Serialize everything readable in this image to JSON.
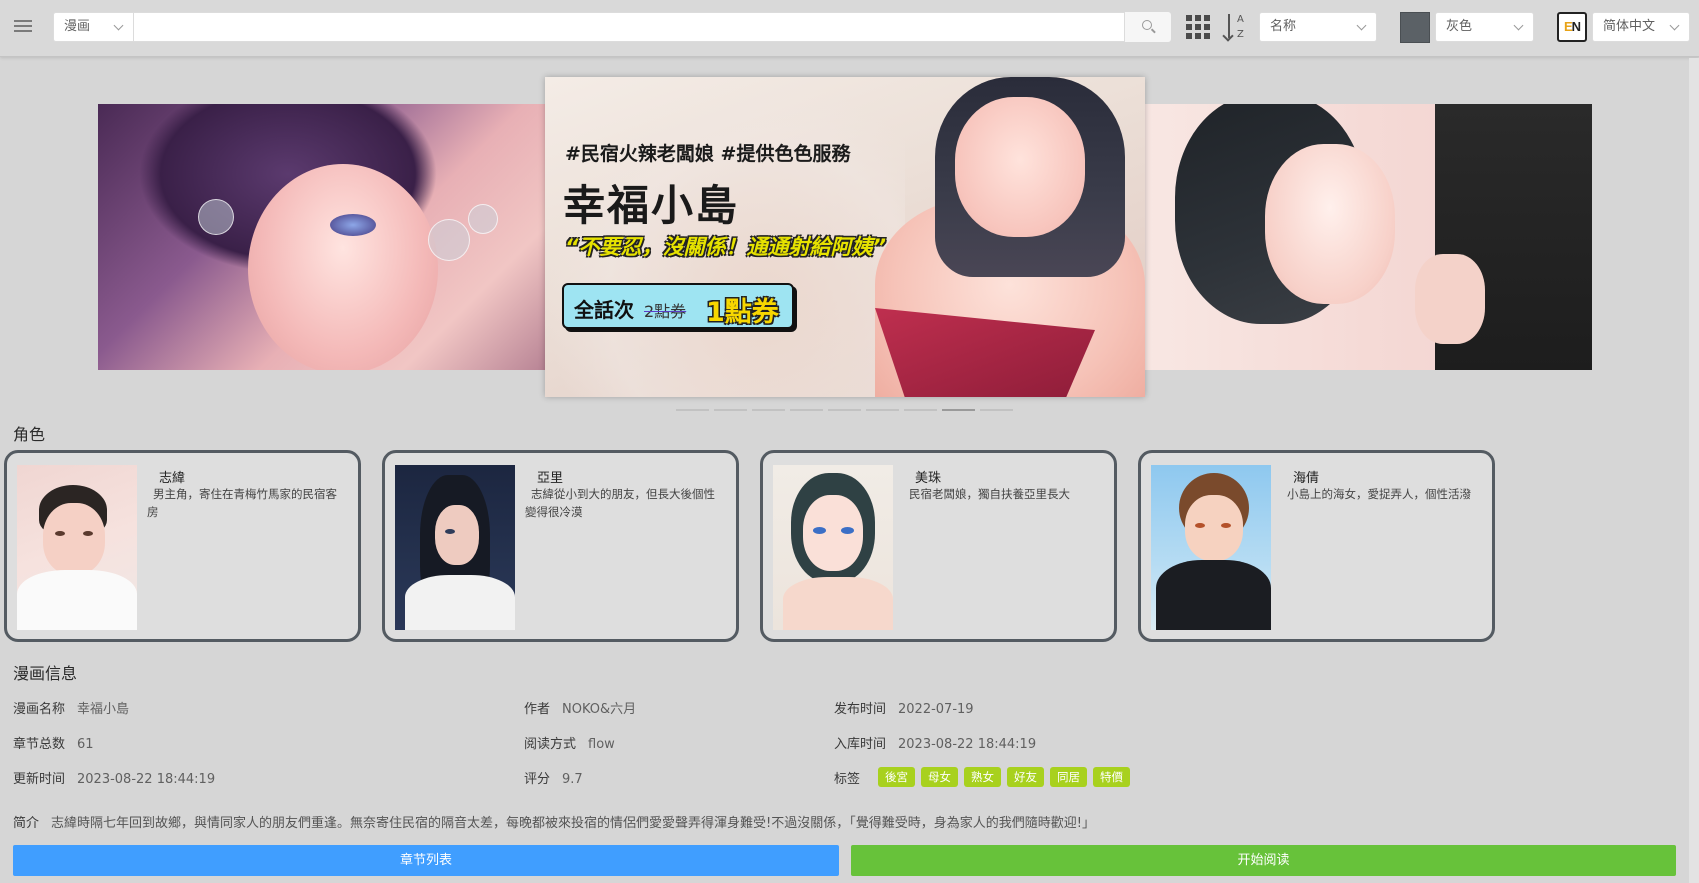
{
  "header": {
    "type_select": "漫画",
    "search_placeholder": "",
    "sort_select": "名称",
    "sort_az": "A\nZ",
    "theme_color": "#5b6166",
    "theme_select": "灰色",
    "lang_icon_e": "E",
    "lang_icon_n": "N",
    "lang_select": "简体中文"
  },
  "banner": {
    "hashtag": "#民宿火辣老闆娘 #提供色色服務",
    "title": "幸福小島",
    "quote": "“不要忍，沒關係！通通射給阿姨”",
    "promo_prefix": "全話次",
    "promo_old": "2點券",
    "promo_new": "1點券",
    "slide_count": 9,
    "active_slide": 7
  },
  "characters": {
    "heading": "角色",
    "items": [
      {
        "name": "志緯",
        "desc": "男主角，寄住在青梅竹馬家的民宿客房"
      },
      {
        "name": "亞里",
        "desc": "志緯從小到大的朋友，但長大後個性變得很冷漠"
      },
      {
        "name": "美珠",
        "desc": "民宿老闆娘，獨自扶養亞里長大"
      },
      {
        "name": "海倩",
        "desc": "小島上的海女，愛捉弄人，個性活潑"
      }
    ]
  },
  "info": {
    "heading": "漫画信息",
    "name_label": "漫画名称",
    "name_value": "幸福小島",
    "author_label": "作者",
    "author_value": "NOKO&六月",
    "release_label": "发布时间",
    "release_value": "2022-07-19",
    "chapters_label": "章节总数",
    "chapters_value": "61",
    "mode_label": "阅读方式",
    "mode_value": "flow",
    "stored_label": "入库时间",
    "stored_value": "2023-08-22 18:44:19",
    "updated_label": "更新时间",
    "updated_value": "2023-08-22 18:44:19",
    "rating_label": "评分",
    "rating_value": "9.7",
    "tags_label": "标签",
    "tags": [
      "後宮",
      "母女",
      "熟女",
      "好友",
      "同居",
      "特價"
    ],
    "summary_label": "简介",
    "summary_value": "志緯時隔七年回到故鄉，與情同家人的朋友們重逢。無奈寄住民宿的隔音太差，每晚都被來投宿的情侶們愛愛聲弄得渾身難受!不過沒關係，「覺得難受時，身為家人的我們隨時歡迎!」"
  },
  "actions": {
    "chapter_list": "章节列表",
    "start_reading": "开始阅读"
  },
  "colors": {
    "primary": "#409eff",
    "success": "#67c23a",
    "tag": "#a8d11e",
    "background": "#d6d6d6",
    "card_border": "#545b62"
  }
}
